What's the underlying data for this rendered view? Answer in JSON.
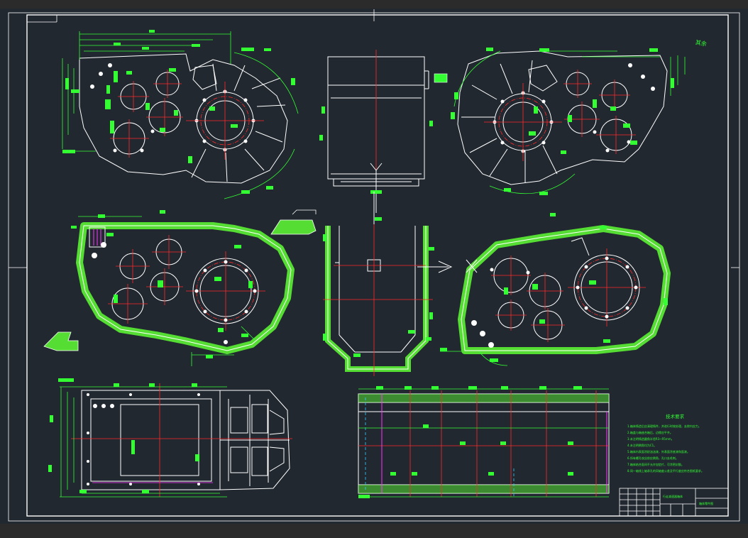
{
  "drawing": {
    "roughness_mark": "其余",
    "technical_requirements_title": "技术要求",
    "technical_requirements_lines": [
      "1.箱体铸造后应清理铸件，并进行时效处理，去除内应力。",
      "2.箱盖与箱座合箱后，边缘应平齐。",
      "3.未注明铸造圆角半径R3~R5mm。",
      "4.未注明倒角均为C1。",
      "5.箱体内表面涂耐油油漆，外表面涂底漆和面漆。",
      "6.所有螺孔攻丝前应倒角，孔口去毛刺。",
      "7.箱体结合面间不允许加垫片，可涂密封胶。",
      "8.同一轴线上轴承孔的同轴度公差及平行度应符合图纸要求。"
    ],
    "title_block": {
      "part_name": "行走减速器箱体",
      "drawing_code": "箱体零件图"
    }
  },
  "colors": {
    "background": "#212830",
    "geometry": "#ffffff",
    "centerline": "#ff2a2a",
    "dimension": "#33ff33",
    "hatch": "#55dd33",
    "highlight": "#ff33ff",
    "aux": "#33ccff"
  }
}
